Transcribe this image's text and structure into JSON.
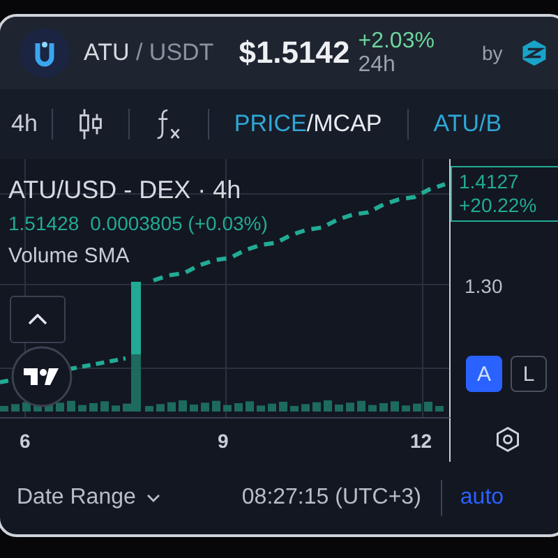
{
  "header": {
    "base": "ATU",
    "separator": "/",
    "quote": "USDT",
    "price": "$1.5142",
    "change": "+2.03%",
    "period": "24h",
    "by": "by"
  },
  "toolbar": {
    "interval": "4h",
    "modes": [
      {
        "label": "PRICE",
        "selected": true
      },
      {
        "label": "MCAP",
        "selected": false
      }
    ],
    "mode_separator": "/",
    "pair_tab": "ATU/B"
  },
  "chart": {
    "title": "ATU/USD - DEX · 4h",
    "ohlc_value": "1.51428",
    "change": "0.0003805 (+0.03%)",
    "indicator": "Volume SMA",
    "last_price": "1.4127",
    "last_change": "+20.22%",
    "axis_label": "1.30",
    "scale_buttons": [
      {
        "label": "A",
        "selected": true
      },
      {
        "label": "L",
        "selected": false
      }
    ],
    "x_labels": [
      "6",
      "9",
      "12"
    ]
  },
  "footer": {
    "date_range": "Date Range",
    "time": "08:27:15 (UTC+3)",
    "auto": "auto"
  }
}
